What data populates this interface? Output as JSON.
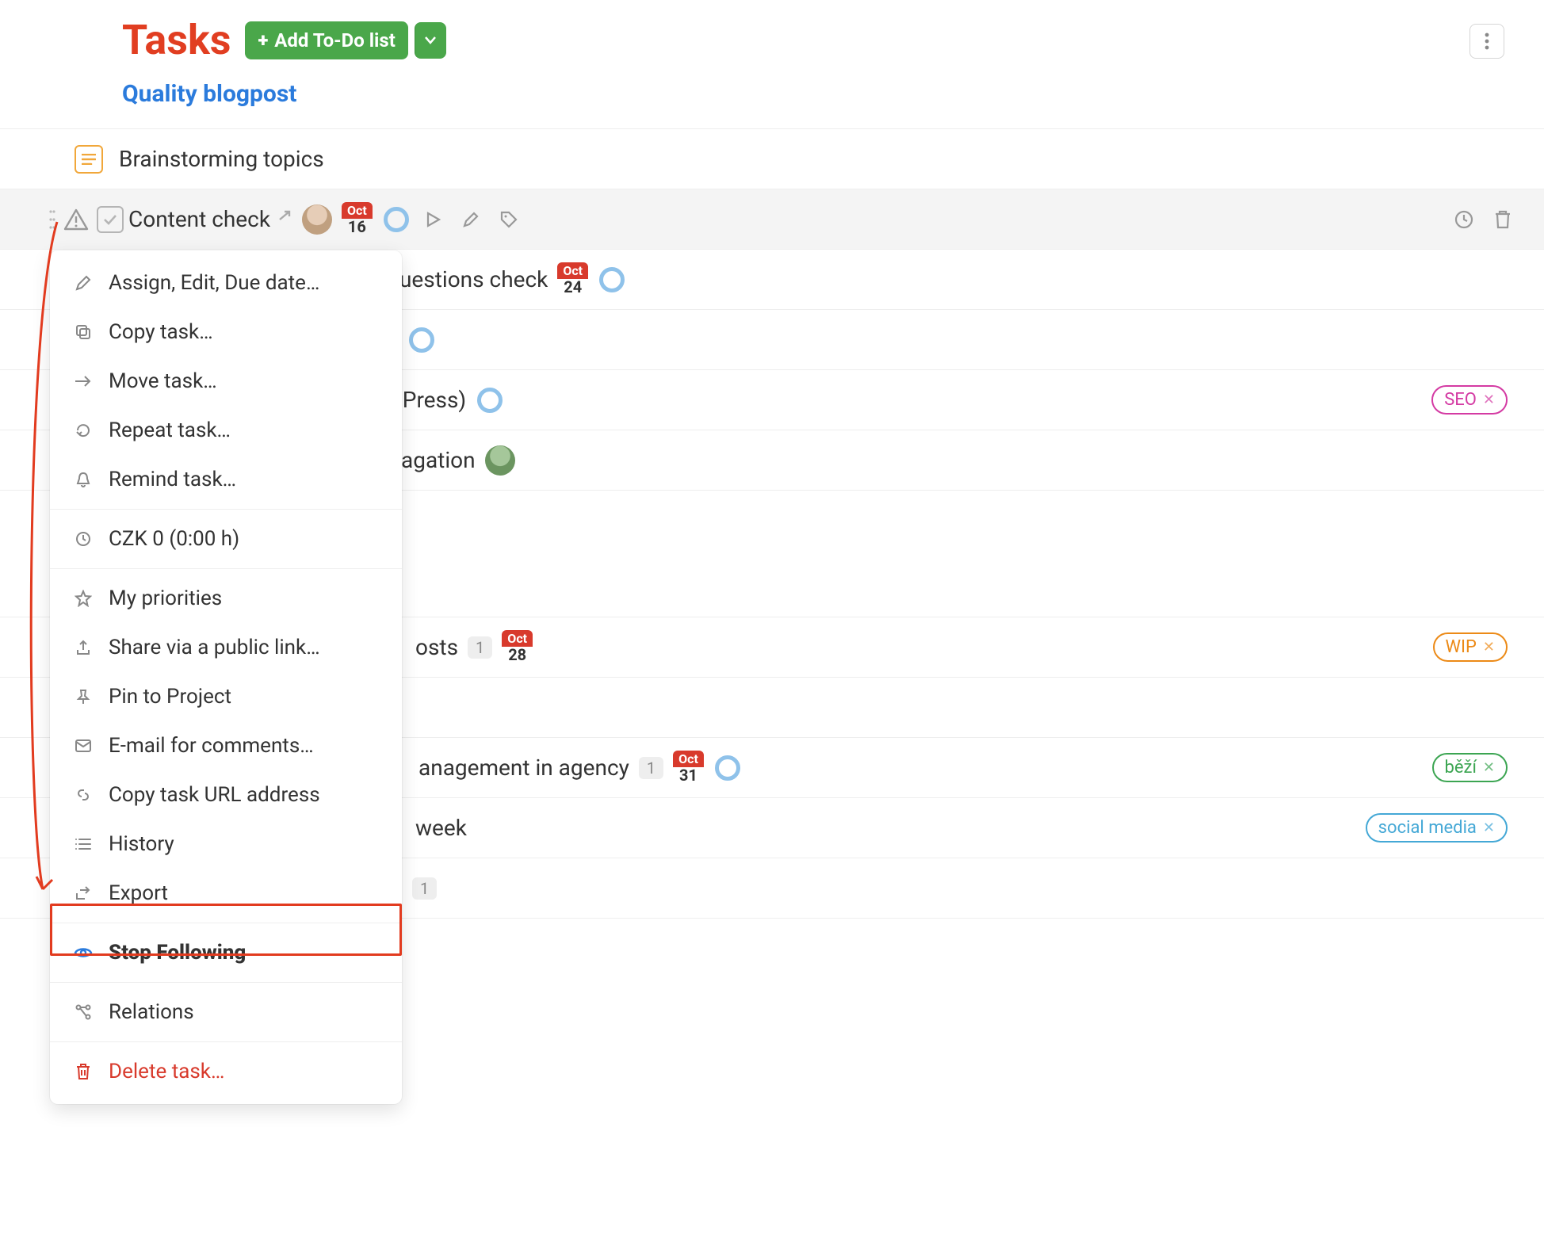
{
  "header": {
    "title": "Tasks",
    "add_label": "Add To-Do list"
  },
  "section": {
    "link": "Quality blogpost"
  },
  "rows": {
    "brainstorming": "Brainstorming topics",
    "content_check": "Content check",
    "content_date_month": "Oct",
    "content_date_day": "16",
    "questions": "uestions check",
    "questions_date_month": "Oct",
    "questions_date_day": "24",
    "dpress": "dPress)",
    "agation": "agation",
    "seo_tag": "SEO",
    "osts": "osts",
    "osts_count": "1",
    "osts_date_month": "Oct",
    "osts_date_day": "28",
    "wip_tag": "WIP",
    "agency": "anagement in agency",
    "agency_count": "1",
    "agency_date_month": "Oct",
    "agency_date_day": "31",
    "bezi_tag": "běží",
    "week": "week",
    "social_tag": "social media",
    "last_count": "1"
  },
  "menu": {
    "assign": "Assign, Edit, Due date…",
    "copy": "Copy task…",
    "move": "Move task…",
    "repeat": "Repeat task…",
    "remind": "Remind task…",
    "budget": "CZK 0 (0:00 h)",
    "priorities": "My priorities",
    "share": "Share via a public link…",
    "pin": "Pin to Project",
    "email": "E-mail for comments…",
    "copy_url": "Copy task URL address",
    "history": "History",
    "export": "Export",
    "stop_follow": "Stop Following",
    "relations": "Relations",
    "delete": "Delete task…"
  }
}
